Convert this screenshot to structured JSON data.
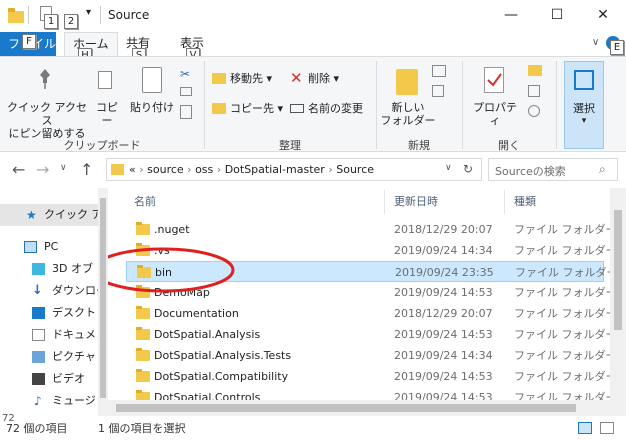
{
  "window": {
    "title": "Source",
    "keytips": [
      "1",
      "2"
    ],
    "minimize": "—",
    "maximize": "☐",
    "close": "✕"
  },
  "ribbon_tabs": {
    "file": "ファイル",
    "file_keytip": "F",
    "home": "ホーム",
    "home_keytip": "H",
    "share": "共有",
    "share_keytip": "S",
    "view": "表示",
    "view_keytip": "V",
    "help_keytip": "E"
  },
  "ribbon": {
    "pin_label_line1": "クイック アクセス",
    "pin_label_line2": "にピン留めする",
    "copy": "コピー",
    "paste": "貼り付け",
    "clipboard_group": "クリップボード",
    "move_to": "移動先 ▾",
    "copy_to": "コピー先 ▾",
    "delete": "削除 ▾",
    "rename": "名前の変更",
    "organize_group": "整理",
    "new_folder_line1": "新しい",
    "new_folder_line2": "フォルダー",
    "new_group": "新規",
    "properties": "プロパティ",
    "open_group": "開く",
    "select": "選択"
  },
  "address": {
    "breadcrumb": [
      "«",
      "source",
      "oss",
      "DotSpatial-master",
      "Source"
    ],
    "search_placeholder": "Sourceの検索"
  },
  "nav": {
    "quick_access": "クイック ア",
    "pc": "PC",
    "objects3d": "3D オブ",
    "downloads": "ダウンロー",
    "desktop": "デスクトッ",
    "documents": "ドキュメン",
    "pictures": "ピクチャ",
    "videos": "ビデオ",
    "music": "ミュージッ"
  },
  "columns": {
    "name": "名前",
    "date": "更新日時",
    "type": "種類"
  },
  "files": [
    {
      "name": ".nuget",
      "date": "2018/12/29 20:07",
      "type": "ファイル フォルダー"
    },
    {
      "name": ".vs",
      "date": "2019/09/24 14:34",
      "type": "ファイル フォルダー"
    },
    {
      "name": "bin",
      "date": "2019/09/24 23:35",
      "type": "ファイル フォルダー"
    },
    {
      "name": "DemoMap",
      "date": "2019/09/24 14:53",
      "type": "ファイル フォルダー"
    },
    {
      "name": "Documentation",
      "date": "2018/12/29 20:07",
      "type": "ファイル フォルダー"
    },
    {
      "name": "DotSpatial.Analysis",
      "date": "2019/09/24 14:53",
      "type": "ファイル フォルダー"
    },
    {
      "name": "DotSpatial.Analysis.Tests",
      "date": "2019/09/24 14:34",
      "type": "ファイル フォルダー"
    },
    {
      "name": "DotSpatial.Compatibility",
      "date": "2019/09/24 14:53",
      "type": "ファイル フォルダー"
    },
    {
      "name": "DotSpatial.Controls",
      "date": "2019/09/24 14:53",
      "type": "ファイル フォルダー"
    }
  ],
  "status": {
    "nav_count": "72",
    "item_count": "72 個の項目",
    "selected": "1 個の項目を選択"
  },
  "colors": {
    "accent": "#1979ca",
    "selection": "#cce8ff",
    "annotation": "#e02020"
  }
}
